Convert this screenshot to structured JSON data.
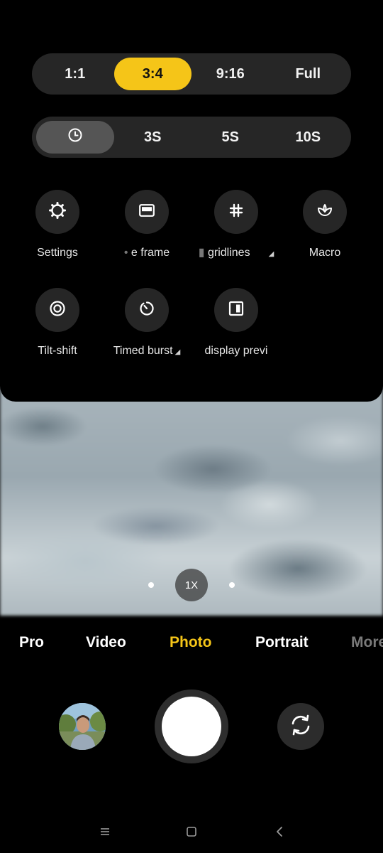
{
  "aspect_ratios": [
    "1:1",
    "3:4",
    "9:16",
    "Full"
  ],
  "aspect_selected": "3:4",
  "timer": {
    "options": [
      "3S",
      "5S",
      "10S"
    ],
    "icon": "timer-icon"
  },
  "tools_row1": [
    {
      "label": "Settings",
      "icon": "gear-icon"
    },
    {
      "label": "e frame",
      "icon": "frame-icon"
    },
    {
      "label": "gridlines",
      "icon": "grid-icon"
    },
    {
      "label": "Macro",
      "icon": "macro-flower-icon"
    }
  ],
  "tools_row2": [
    {
      "label": "Tilt-shift",
      "icon": "tilt-shift-icon"
    },
    {
      "label": "Timed burst",
      "icon": "timed-burst-icon"
    },
    {
      "label": "display previ",
      "icon": "display-preview-icon"
    }
  ],
  "zoom": {
    "label": "1X"
  },
  "modes": [
    "Pro",
    "Video",
    "Photo",
    "Portrait",
    "More"
  ],
  "mode_selected": "Photo",
  "colors": {
    "accent": "#f5c518",
    "panel": "#262626"
  }
}
